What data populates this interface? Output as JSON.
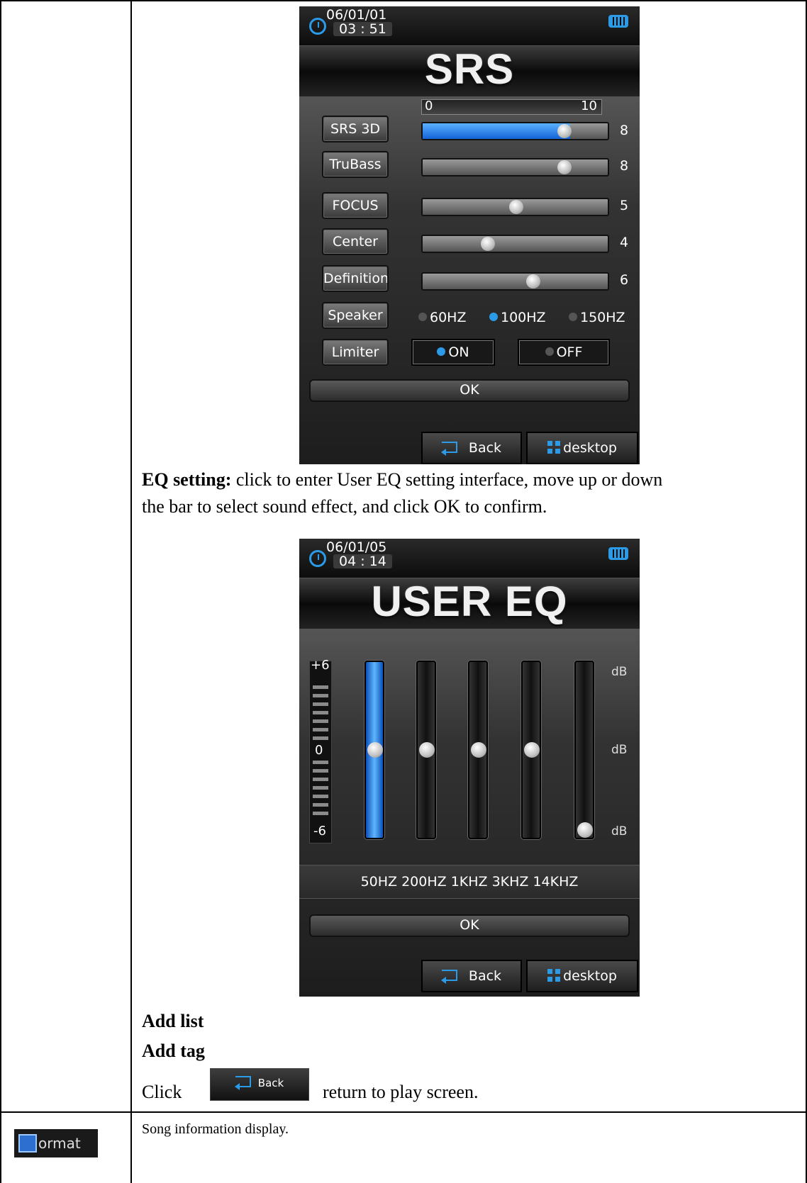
{
  "srs_screen": {
    "date": "06/01/01",
    "time": "03 : 51",
    "title": "SRS",
    "scale_min": "0",
    "scale_max": "10",
    "rows": [
      {
        "label": "SRS 3D",
        "value": "8",
        "active": true
      },
      {
        "label": "TruBass",
        "value": "8"
      },
      {
        "label": "FOCUS",
        "value": "5"
      },
      {
        "label": "Center",
        "value": "4"
      },
      {
        "label": "Definition",
        "value": "6"
      }
    ],
    "speaker_label": "Speaker",
    "speaker_options": [
      "60HZ",
      "100HZ",
      "150HZ"
    ],
    "speaker_selected": "100HZ",
    "limiter_label": "Limiter",
    "limiter_on": "ON",
    "limiter_off": "OFF",
    "ok": "OK",
    "back": "Back",
    "desktop": "desktop"
  },
  "eq_description": {
    "bold": "EQ setting:",
    "text": " click to enter User EQ setting interface, move up or down",
    "text2": "the bar to select sound effect, and click OK to confirm."
  },
  "eq_screen": {
    "date": "06/01/05",
    "time": "04 : 14",
    "title": "USER EQ",
    "scale_top": "+6",
    "scale_mid": "0",
    "scale_bottom": "-6",
    "db_label": "dB",
    "frequencies": "50HZ 200HZ  1KHZ  3KHZ  14KHZ",
    "band_levels_db": [
      0,
      0,
      0,
      0,
      -6
    ],
    "ok": "OK",
    "back": "Back",
    "desktop": "desktop"
  },
  "menu_items": [
    "Add list",
    "Add tag"
  ],
  "back_instruction": {
    "prefix": "Click",
    "button": "Back",
    "suffix": "return to play screen."
  },
  "format_row": {
    "icon_text": "ormat",
    "description": "Song information display."
  }
}
